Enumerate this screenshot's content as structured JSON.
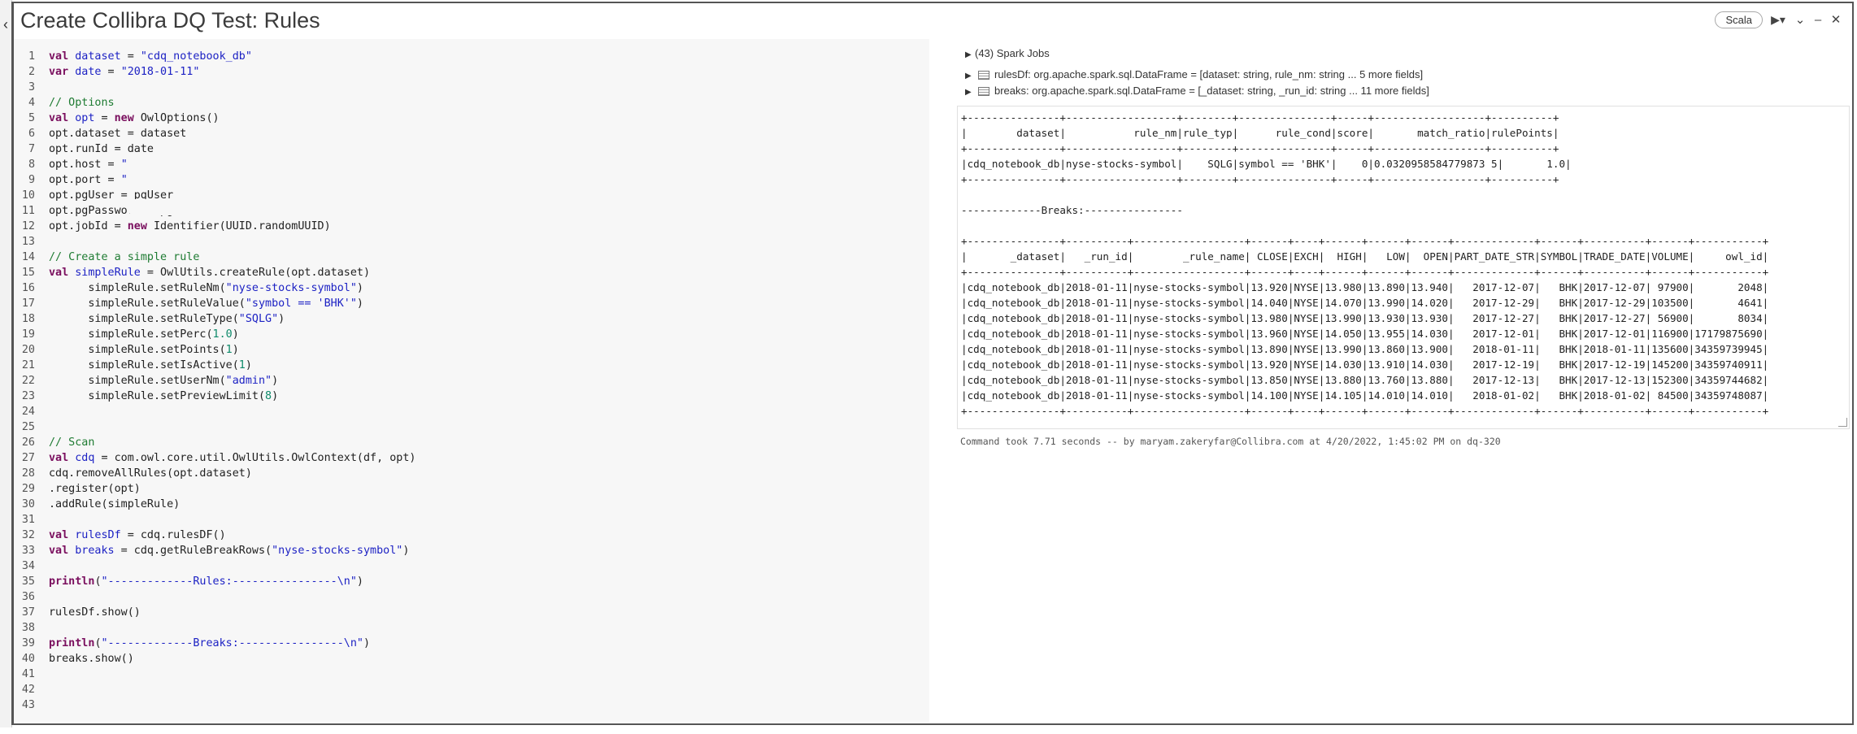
{
  "cell": {
    "title": "Create Collibra DQ Test: Rules",
    "language": "Scala",
    "run_icon": "▶▾",
    "collapse_icon": "⌄",
    "minimize_icon": "–",
    "close_icon": "✕",
    "left_collapse_icon": "‹"
  },
  "editor": {
    "lines": [
      [
        {
          "t": "val ",
          "c": "kw"
        },
        {
          "t": "dataset",
          "c": "def"
        },
        {
          "t": " = "
        },
        {
          "t": "\"cdq_notebook_db\"",
          "c": "str"
        }
      ],
      [
        {
          "t": "var ",
          "c": "kw"
        },
        {
          "t": "date",
          "c": "def"
        },
        {
          "t": " = "
        },
        {
          "t": "\"2018-01-11\"",
          "c": "str"
        }
      ],
      [],
      [
        {
          "t": "// Options",
          "c": "cmt"
        }
      ],
      [
        {
          "t": "val ",
          "c": "kw"
        },
        {
          "t": "opt",
          "c": "def"
        },
        {
          "t": " = "
        },
        {
          "t": "new ",
          "c": "kw"
        },
        {
          "t": "OwlOptions()"
        }
      ],
      [
        {
          "t": "opt.dataset = dataset"
        }
      ],
      [
        {
          "t": "opt.runId = date"
        }
      ],
      [
        {
          "t": "opt.host = "
        },
        {
          "t": "\"",
          "c": "str"
        }
      ],
      [
        {
          "t": "opt.port = "
        },
        {
          "t": "\"",
          "c": "str"
        }
      ],
      [
        {
          "t": "opt.pgUser = pgUser"
        }
      ],
      [
        {
          "t": "opt.pgPassword = pgPass"
        }
      ],
      [
        {
          "t": "opt.jobId = "
        },
        {
          "t": "new ",
          "c": "kw"
        },
        {
          "t": "Identifier(UUID.randomUUID)"
        }
      ],
      [],
      [
        {
          "t": "// Create a simple rule",
          "c": "cmt"
        }
      ],
      [
        {
          "t": "val ",
          "c": "kw"
        },
        {
          "t": "simpleRule",
          "c": "def"
        },
        {
          "t": " = OwlUtils.createRule(opt.dataset)"
        }
      ],
      [
        {
          "t": "      simpleRule.setRuleNm("
        },
        {
          "t": "\"nyse-stocks-symbol\"",
          "c": "str"
        },
        {
          "t": ")"
        }
      ],
      [
        {
          "t": "      simpleRule.setRuleValue("
        },
        {
          "t": "\"symbol == 'BHK'\"",
          "c": "str"
        },
        {
          "t": ")"
        }
      ],
      [
        {
          "t": "      simpleRule.setRuleType("
        },
        {
          "t": "\"SQLG\"",
          "c": "str"
        },
        {
          "t": ")"
        }
      ],
      [
        {
          "t": "      simpleRule.setPerc("
        },
        {
          "t": "1.0",
          "c": "num"
        },
        {
          "t": ")"
        }
      ],
      [
        {
          "t": "      simpleRule.setPoints("
        },
        {
          "t": "1",
          "c": "num"
        },
        {
          "t": ")"
        }
      ],
      [
        {
          "t": "      simpleRule.setIsActive("
        },
        {
          "t": "1",
          "c": "num"
        },
        {
          "t": ")"
        }
      ],
      [
        {
          "t": "      simpleRule.setUserNm("
        },
        {
          "t": "\"admin\"",
          "c": "str"
        },
        {
          "t": ")"
        }
      ],
      [
        {
          "t": "      simpleRule.setPreviewLimit("
        },
        {
          "t": "8",
          "c": "num"
        },
        {
          "t": ")"
        }
      ],
      [],
      [],
      [
        {
          "t": "// Scan",
          "c": "cmt"
        }
      ],
      [
        {
          "t": "val ",
          "c": "kw"
        },
        {
          "t": "cdq",
          "c": "def"
        },
        {
          "t": " = com.owl.core.util.OwlUtils.OwlContext(df, opt)"
        }
      ],
      [
        {
          "t": "cdq.removeAllRules(opt.dataset)"
        }
      ],
      [
        {
          "t": ".register(opt)"
        }
      ],
      [
        {
          "t": ".addRule(simpleRule)"
        }
      ],
      [],
      [
        {
          "t": "val ",
          "c": "kw"
        },
        {
          "t": "rulesDf",
          "c": "def"
        },
        {
          "t": " = cdq.rulesDF()"
        }
      ],
      [
        {
          "t": "val ",
          "c": "kw"
        },
        {
          "t": "breaks",
          "c": "def"
        },
        {
          "t": " = cdq.getRuleBreakRows("
        },
        {
          "t": "\"nyse-stocks-symbol\"",
          "c": "str"
        },
        {
          "t": ")"
        }
      ],
      [],
      [
        {
          "t": "println",
          "c": "kw"
        },
        {
          "t": "("
        },
        {
          "t": "\"-------------Rules:----------------\\n\"",
          "c": "str"
        },
        {
          "t": ")"
        }
      ],
      [],
      [
        {
          "t": "rulesDf.show()"
        }
      ],
      [],
      [
        {
          "t": "println",
          "c": "kw"
        },
        {
          "t": "("
        },
        {
          "t": "\"-------------Breaks:----------------\\n\"",
          "c": "str"
        },
        {
          "t": ")"
        }
      ],
      [
        {
          "t": "breaks.show()"
        }
      ],
      [],
      [],
      []
    ]
  },
  "output": {
    "spark_jobs": "(43) Spark Jobs",
    "dataframes": [
      {
        "name": "rulesDf:",
        "type": "org.apache.spark.sql.DataFrame = [dataset: string, rule_nm: string ... 5 more fields]"
      },
      {
        "name": "breaks:",
        "type": "org.apache.spark.sql.DataFrame = [_dataset: string, _run_id: string ... 11 more fields]"
      }
    ],
    "text_lines": [
      "+---------------+------------------+--------+---------------+-----+------------------+----------+",
      "|        dataset|           rule_nm|rule_typ|      rule_cond|score|       match_ratio|rulePoints|",
      "+---------------+------------------+--------+---------------+-----+------------------+----------+",
      "|cdq_notebook_db|nyse-stocks-symbol|    SQLG|symbol == 'BHK'|    0|0.0320958584779873 5|       1.0|",
      "+---------------+------------------+--------+---------------+-----+------------------+----------+",
      "",
      "-------------Breaks:----------------",
      "",
      "+---------------+----------+------------------+------+----+------+------+------+-------------+------+----------+------+-----------+",
      "|       _dataset|   _run_id|        _rule_name| CLOSE|EXCH|  HIGH|   LOW|  OPEN|PART_DATE_STR|SYMBOL|TRADE_DATE|VOLUME|     owl_id|",
      "+---------------+----------+------------------+------+----+------+------+------+-------------+------+----------+------+-----------+",
      "|cdq_notebook_db|2018-01-11|nyse-stocks-symbol|13.920|NYSE|13.980|13.890|13.940|   2017-12-07|   BHK|2017-12-07| 97900|       2048|",
      "|cdq_notebook_db|2018-01-11|nyse-stocks-symbol|14.040|NYSE|14.070|13.990|14.020|   2017-12-29|   BHK|2017-12-29|103500|       4641|",
      "|cdq_notebook_db|2018-01-11|nyse-stocks-symbol|13.980|NYSE|13.990|13.930|13.930|   2017-12-27|   BHK|2017-12-27| 56900|       8034|",
      "|cdq_notebook_db|2018-01-11|nyse-stocks-symbol|13.960|NYSE|14.050|13.955|14.030|   2017-12-01|   BHK|2017-12-01|116900|17179875690|",
      "|cdq_notebook_db|2018-01-11|nyse-stocks-symbol|13.890|NYSE|13.990|13.860|13.900|   2018-01-11|   BHK|2018-01-11|135600|34359739945|",
      "|cdq_notebook_db|2018-01-11|nyse-stocks-symbol|13.920|NYSE|14.030|13.910|14.030|   2017-12-19|   BHK|2017-12-19|145200|34359740911|",
      "|cdq_notebook_db|2018-01-11|nyse-stocks-symbol|13.850|NYSE|13.880|13.760|13.880|   2017-12-13|   BHK|2017-12-13|152300|34359744682|",
      "|cdq_notebook_db|2018-01-11|nyse-stocks-symbol|14.100|NYSE|14.105|14.010|14.010|   2018-01-02|   BHK|2018-01-02| 84500|34359748087|",
      "+---------------+----------+------------------+------+----+------+------+------+-------------+------+----------+------+-----------+"
    ],
    "command_took": "Command took 7.71 seconds -- by maryam.zakeryfar@Collibra.com at 4/20/2022, 1:45:02 PM on dq-320"
  }
}
